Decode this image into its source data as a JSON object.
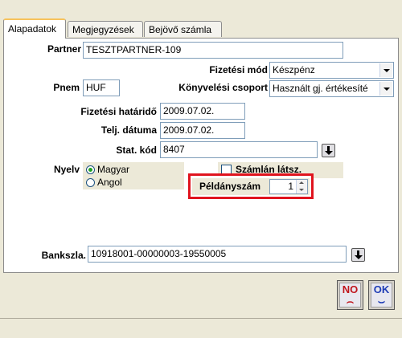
{
  "tabs": [
    {
      "label": "Alapadatok",
      "active": true
    },
    {
      "label": "Megjegyzések",
      "active": false
    },
    {
      "label": "Bejövő számla",
      "active": false
    }
  ],
  "form": {
    "partner_label": "Partner",
    "partner_value": "TESZTPARTNER-109",
    "fizetesi_mod_label": "Fizetési mód",
    "fizetesi_mod_value": "Készpénz",
    "pnem_label": "Pnem",
    "pnem_value": "HUF",
    "konyvelesi_label": "Könyvelési csoport",
    "konyvelesi_value": "Használt gj. értékesíté",
    "hatarido_label": "Fizetési határidő",
    "hatarido_value": "2009.07.02.",
    "telj_label": "Telj. dátuma",
    "telj_value": "2009.07.02.",
    "stat_label": "Stat. kód",
    "stat_value": "8407",
    "nyelv_label": "Nyelv",
    "nyelv_options": [
      {
        "label": "Magyar",
        "selected": true
      },
      {
        "label": "Angol",
        "selected": false
      }
    ],
    "szamlan_label": "Számlán látsz.",
    "szamlan_checked": false,
    "peldanyszam_label": "Példányszám",
    "peldanyszam_value": "1",
    "bankszla_label": "Bankszla.",
    "bankszla_value": "10918001-00000003-19550005"
  },
  "buttons": {
    "no_label": "NO",
    "ok_label": "OK"
  },
  "colors": {
    "highlight_border": "#e0141e",
    "selected_radio": "#21a121",
    "tab_accent": "#f7c35c"
  }
}
